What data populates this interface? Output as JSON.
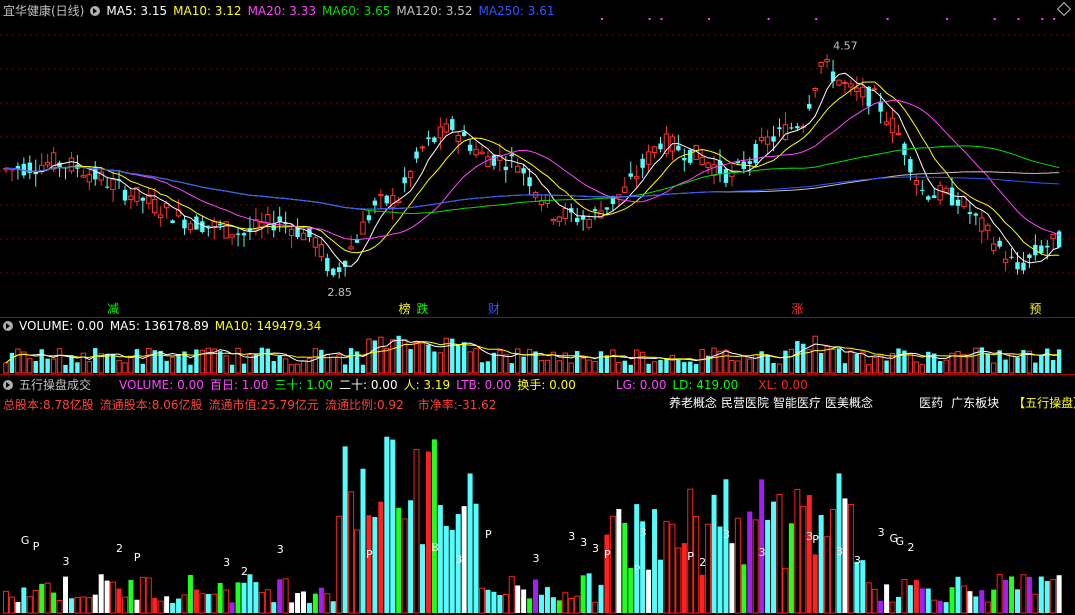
{
  "colors": {
    "up": "#ff3232",
    "down": "#54fcfc",
    "ma5": "#ffffff",
    "ma10": "#ffff00",
    "ma20": "#ff44ff",
    "ma60": "#00e000",
    "ma120": "#c0c0c0",
    "ma250": "#3355ff",
    "purple": "#a020f0",
    "green": "#20ff20",
    "white": "#ffffff",
    "red": "#ff2020",
    "cyan": "#54fcfc",
    "label": "#ff3fff",
    "yellow": "#ffff00"
  },
  "price": {
    "title": "宜华健康(日线)",
    "ma": [
      {
        "label": "MA5: 3.15",
        "color": "#ffffff"
      },
      {
        "label": "MA10: 3.12",
        "color": "#ffff00"
      },
      {
        "label": "MA20: 3.33",
        "color": "#ff44ff"
      },
      {
        "label": "MA60: 3.65",
        "color": "#00e000"
      },
      {
        "label": "MA120: 3.52",
        "color": "#c0c0c0"
      },
      {
        "label": "MA250: 3.61",
        "color": "#3355ff"
      }
    ],
    "high_label": "4.57",
    "low_label": "2.85",
    "events": [
      {
        "text": "减",
        "color": "#00ff00",
        "idx": 18
      },
      {
        "text": "榜",
        "color": "#ffff00",
        "idx": 67
      },
      {
        "text": "跌",
        "color": "#00ff00",
        "idx": 70
      },
      {
        "text": "财",
        "color": "#3355ff",
        "idx": 82
      },
      {
        "text": "涨",
        "color": "#ff3030",
        "idx": 133
      },
      {
        "text": "预",
        "color": "#ffff00",
        "idx": 173
      }
    ],
    "ymin": 2.75,
    "ymax": 4.75
  },
  "volume": {
    "labels": [
      {
        "text": "VOLUME: 0.00",
        "color": "#ffffff"
      },
      {
        "text": "MA5: 136178.89",
        "color": "#ffffff"
      },
      {
        "text": "MA10: 149479.34",
        "color": "#ffff00"
      }
    ]
  },
  "indicator": {
    "title": "五行操盘成交",
    "stats": [
      {
        "text": "VOLUME: 0.00",
        "color": "#ff44ff"
      },
      {
        "text": "百日: 1.00",
        "color": "#ff44ff"
      },
      {
        "text": "三十: 1.00",
        "color": "#00ff00"
      },
      {
        "text": "二十: 0.00",
        "color": "#ffffff"
      },
      {
        "text": "人: 3.19",
        "color": "#ffff00"
      },
      {
        "text": "LTB: 0.00",
        "color": "#ff44ff"
      },
      {
        "text": "换手: 0.00",
        "color": "#ffff00"
      },
      {
        "text": "LG: 0.00",
        "color": "#ff44ff"
      },
      {
        "text": "LD: 419.00",
        "color": "#00ff00"
      },
      {
        "text": "XL: 0.00",
        "color": "#ff2020"
      }
    ],
    "info": [
      "总股本:8.78亿股",
      "流通股本:8.06亿股",
      "流通市值:25.79亿元",
      "流通比例:0.92",
      "市净率:-31.62"
    ],
    "tags": [
      "养老概念",
      "民营医院",
      "智能医疗",
      "医美概念"
    ],
    "tags2": [
      "医药",
      "广东板块"
    ],
    "special_tag": "【五行操盘】",
    "marks": [
      {
        "t": "G",
        "i": 3
      },
      {
        "t": "P",
        "i": 5
      },
      {
        "t": "3",
        "i": 10
      },
      {
        "t": "2",
        "i": 19
      },
      {
        "t": "P",
        "i": 22
      },
      {
        "t": "3",
        "i": 37
      },
      {
        "t": "2",
        "i": 40
      },
      {
        "t": "3",
        "i": 46
      },
      {
        "t": "P",
        "i": 61
      },
      {
        "t": "B",
        "i": 72
      },
      {
        "t": "3",
        "i": 76
      },
      {
        "t": "P",
        "i": 81
      },
      {
        "t": "3",
        "i": 89
      },
      {
        "t": "3",
        "i": 95
      },
      {
        "t": "3",
        "i": 97
      },
      {
        "t": "3",
        "i": 99
      },
      {
        "t": "P",
        "i": 101
      },
      {
        "t": "P",
        "i": 106
      },
      {
        "t": "3",
        "i": 107
      },
      {
        "t": "P",
        "i": 115
      },
      {
        "t": "2",
        "i": 117
      },
      {
        "t": "3",
        "i": 121
      },
      {
        "t": "3",
        "i": 127
      },
      {
        "t": "3",
        "i": 135
      },
      {
        "t": "P",
        "i": 136
      },
      {
        "t": "3",
        "i": 140
      },
      {
        "t": "3",
        "i": 143
      },
      {
        "t": "3",
        "i": 147
      },
      {
        "t": "G",
        "i": 149
      },
      {
        "t": "G",
        "i": 150
      },
      {
        "t": "2",
        "i": 152
      }
    ]
  }
}
